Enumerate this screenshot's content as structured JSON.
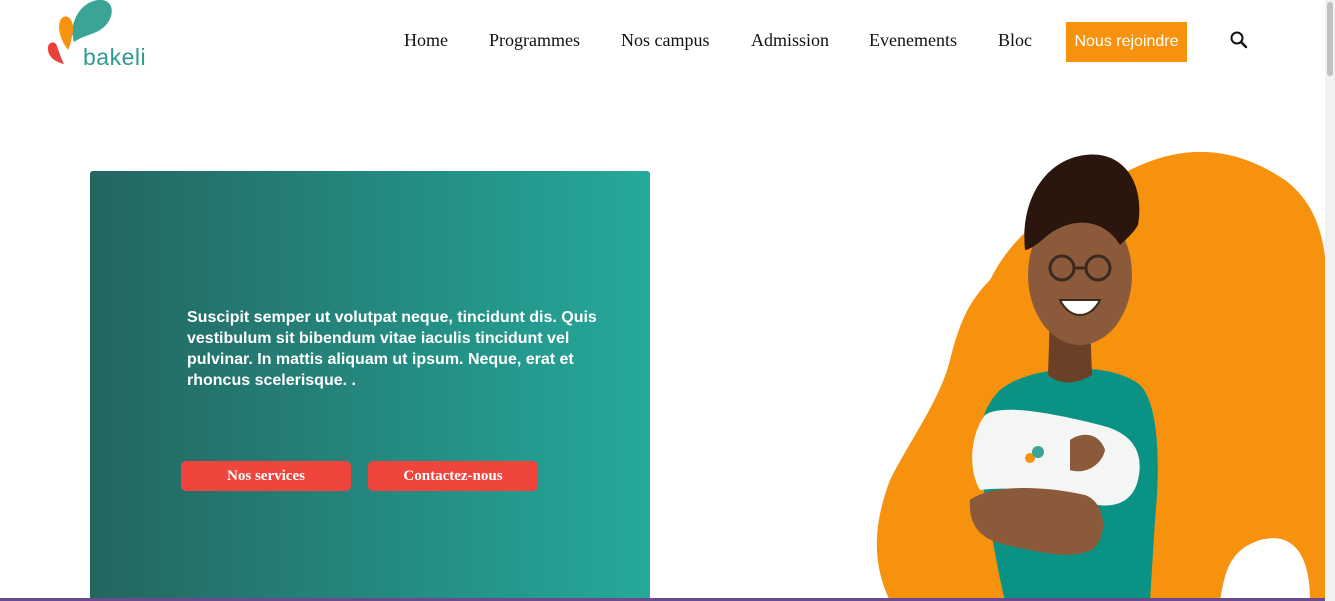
{
  "brand": {
    "name": "bakeli"
  },
  "nav": {
    "items": [
      {
        "label": "Home"
      },
      {
        "label": "Programmes"
      },
      {
        "label": "Nos campus"
      },
      {
        "label": "Admission"
      },
      {
        "label": "Evenements"
      },
      {
        "label": "Bloc"
      }
    ],
    "cta": "Nous rejoindre"
  },
  "hero": {
    "text": "Suscipit semper ut volutpat neque, tincidunt dis. Quis vestibulum sit bibendum vitae iaculis tincidunt vel pulvinar. In mattis aliquam ut ipsum. Neque, erat et rhoncus scelerisque. .",
    "buttons": {
      "services": "Nos services",
      "contact": "Contactez-nous"
    }
  },
  "colors": {
    "accent_orange": "#f7920f",
    "teal_dark": "#236660",
    "teal_light": "#25a99b",
    "button_red": "#f0453d"
  },
  "icons": {
    "search": "search-icon",
    "logo": "bakeli-logo-icon"
  }
}
